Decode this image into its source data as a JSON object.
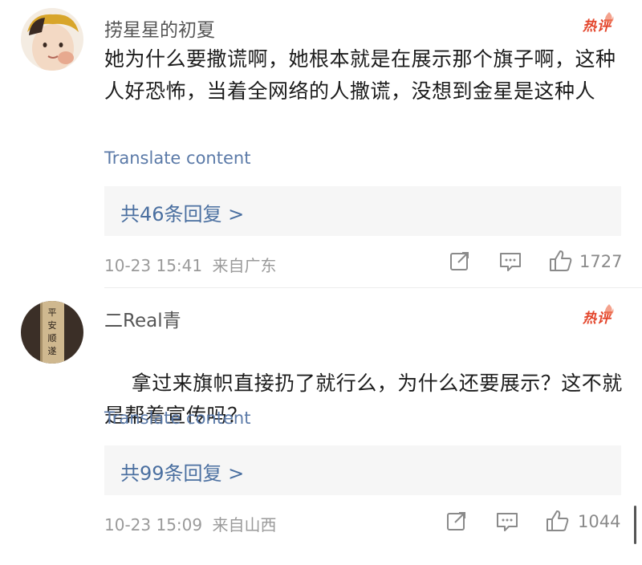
{
  "comments": [
    {
      "username": "捞星星的初夏",
      "hot_label": "热评",
      "text": "她为什么要撒谎啊，她根本就是在展示那个旗子啊，这种人好恐怖，当着全网络的人撒谎，没想到金星是这种人",
      "translate_label": "Translate content",
      "replies_label": "共46条回复 >",
      "timestamp": "10-23 15:41",
      "location": "来自广东",
      "like_count": "1727",
      "icons": [
        "share-icon",
        "comment-icon",
        "like-icon"
      ]
    },
    {
      "username": "二Real青",
      "hot_label": "热评",
      "text": "拿过来旗帜直接扔了就行么，为什么还要展示？这不就是帮着宣传吗？",
      "translate_label": "Translate content",
      "replies_label": "共99条回复 >",
      "timestamp": "10-23 15:09",
      "location": "来自山西",
      "like_count": "1044",
      "icons": [
        "share-icon",
        "comment-icon",
        "like-icon"
      ],
      "emoji": "doge-emoji"
    }
  ],
  "colors": {
    "hot": "#e3452b",
    "link": "#5b7aa8",
    "reply_text": "#4a6fa0",
    "reply_bg": "#f6f6f6",
    "meta": "#9a9a9a"
  }
}
